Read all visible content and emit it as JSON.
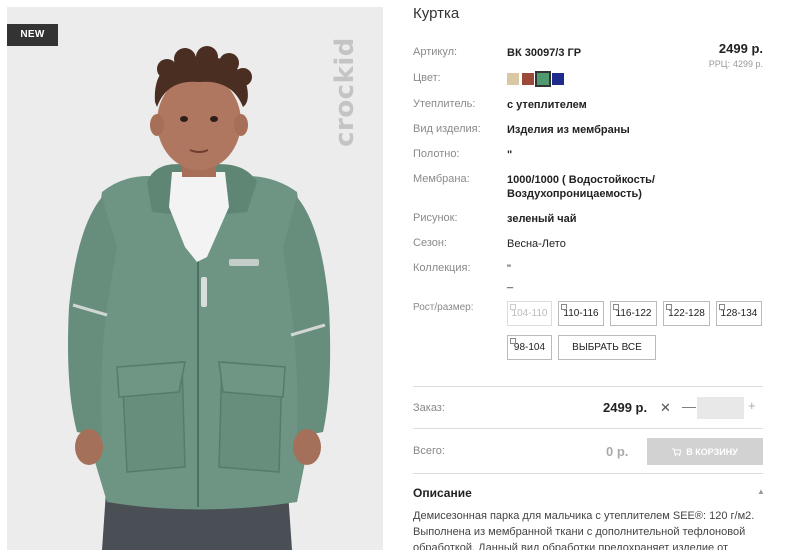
{
  "badge": "NEW",
  "brand_watermark": "crockid",
  "product": {
    "title": "Куртка",
    "price": "2499 р.",
    "rrp_label": "РРЦ:",
    "rrp_value": "4299 р."
  },
  "specs": [
    {
      "label": "Артикул:",
      "value": "ВК 30097/3 ГР"
    },
    {
      "label": "Цвет:",
      "value": ""
    },
    {
      "label": "Утеплитель:",
      "value": "с утеплителем"
    },
    {
      "label": "Вид изделия:",
      "value": "Изделия из мембраны"
    },
    {
      "label": "Полотно:",
      "value": "\""
    },
    {
      "label": "Мембрана:",
      "value": "1000/1000 ( Водостойкость/ Воздухопроницаемость)"
    },
    {
      "label": "Рисунок:",
      "value": "зеленый чай"
    },
    {
      "label": "Сезон:",
      "value": "Весна-Лето"
    },
    {
      "label": "Коллекция:",
      "value": "\" _"
    },
    {
      "label": "Рост/размер:",
      "value": ""
    }
  ],
  "colors": [
    {
      "name": "beige",
      "hex": "#d9c8a3",
      "selected": false
    },
    {
      "name": "brown",
      "hex": "#9b4a3a",
      "selected": false
    },
    {
      "name": "green",
      "hex": "#4f9a6e",
      "selected": true
    },
    {
      "name": "navy",
      "hex": "#1e2a8c",
      "selected": false
    }
  ],
  "sizes": [
    {
      "label": "104-110",
      "available": false
    },
    {
      "label": "110-116",
      "available": true
    },
    {
      "label": "116-122",
      "available": true
    },
    {
      "label": "122-128",
      "available": true
    },
    {
      "label": "128-134",
      "available": true
    },
    {
      "label": "98-104",
      "available": true
    }
  ],
  "select_all_label": "ВЫБРАТЬ ВСЕ",
  "order": {
    "label": "Заказ:",
    "price": "2499 р.",
    "clear_icon": "close-icon",
    "minus": "—",
    "plus": "+",
    "quantity": ""
  },
  "total": {
    "label": "Всего:",
    "value": "0 р."
  },
  "cart_button_label": "В КОРЗИНУ",
  "description": {
    "heading": "Описание",
    "text": "Демисезонная парка для мальчика с утеплителем SEE®: 120 г/м2. Выполнена из мембранной ткани с дополнительной тефлоновой обработкой. Данный вид обработки предохраняет изделие от"
  },
  "accent_colors": {
    "badge_bg": "#333333",
    "cart_button_bg": "#d2d2d2",
    "jacket": "#6e9484"
  }
}
